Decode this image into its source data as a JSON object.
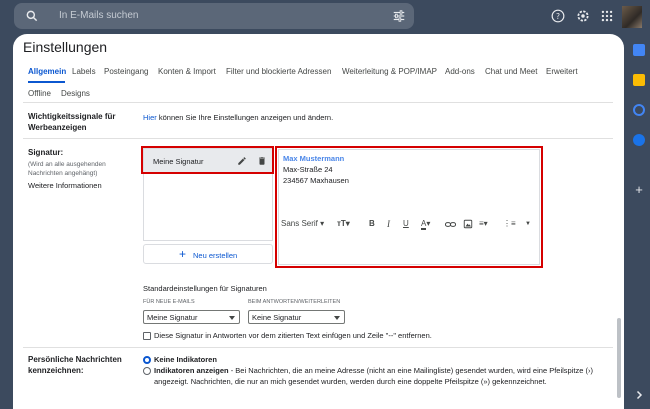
{
  "topbar": {
    "search_placeholder": "In E-Mails suchen"
  },
  "settings": {
    "title": "Einstellungen",
    "tabs": [
      "Allgemein",
      "Labels",
      "Posteingang",
      "Konten & Import",
      "Filter und blockierte Adressen",
      "Weiterleitung & POP/IMAP",
      "Add-ons",
      "Chat und Meet",
      "Erweitert"
    ],
    "tabs_row2": [
      "Offline",
      "Designs"
    ]
  },
  "ads": {
    "label": "Wichtigkeitssignale für Werbeanzeigen",
    "link": "Hier",
    "text": "können Sie Ihre Einstellungen anzeigen und ändern."
  },
  "signature": {
    "label": "Signatur:",
    "hint": "(Wird an alle ausgehenden Nachrichten angehängt)",
    "more_info": "Weitere Informationen",
    "item_name": "Meine Signatur",
    "content": {
      "name": "Max Mustermann",
      "street": "Max-Straße 24",
      "city": "234567 Maxhausen"
    },
    "toolbar": {
      "font": "Sans Serif"
    },
    "new_button": "Neu erstellen",
    "defaults_title": "Standardeinstellungen für Signaturen",
    "for_new_label": "FÜR NEUE E-MAILS",
    "for_reply_label": "BEIM ANTWORTEN/WEITERLEITEN",
    "for_new_value": "Meine Signatur",
    "for_reply_value": "Keine Signatur",
    "checkbox_text": "Diese Signatur in Antworten vor dem zitierten Text einfügen und Zeile \"--\" entfernen."
  },
  "personal": {
    "label": "Persönliche Nachrichten kennzeichnen:",
    "option1": "Keine Indikatoren",
    "option2_title": "Indikatoren anzeigen",
    "option2_text": " - Bei Nachrichten, die an meine Adresse (nicht an eine Mailingliste) gesendet wurden, wird eine Pfeilspitze (›) angezeigt. Nachrichten, die nur an mich gesendet wurden, werden durch eine doppelte Pfeilspitze (») gekennzeichnet."
  },
  "colors": {
    "accent": "#0b57d0",
    "highlight_box": "#d50000",
    "background": "#3c4a5e"
  }
}
